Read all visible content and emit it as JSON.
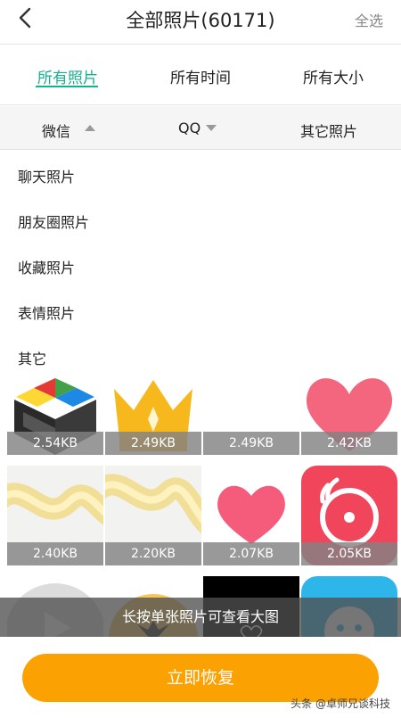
{
  "header": {
    "title": "全部照片(60171)",
    "select_all": "全选"
  },
  "filters": [
    {
      "label": "所有照片",
      "active": true
    },
    {
      "label": "所有时间",
      "active": false
    },
    {
      "label": "所有大小",
      "active": false
    }
  ],
  "sources": {
    "wechat": "微信",
    "qq": "QQ",
    "other": "其它照片"
  },
  "categories": [
    "聊天照片",
    "朋友圈照片",
    "收藏照片",
    "表情照片",
    "其它"
  ],
  "photos": [
    {
      "size": "2.54KB",
      "icon": "colorful-box-logo-icon"
    },
    {
      "size": "2.49KB",
      "icon": "crown-icon"
    },
    {
      "size": "2.49KB",
      "icon": "blank-image"
    },
    {
      "size": "2.42KB",
      "icon": "heart-icon"
    },
    {
      "size": "2.40KB",
      "icon": "golden-ribbon-image"
    },
    {
      "size": "2.20KB",
      "icon": "golden-ribbon-image"
    },
    {
      "size": "2.07KB",
      "icon": "heart-icon"
    },
    {
      "size": "2.05KB",
      "icon": "radio-app-icon"
    },
    {
      "icon": "play-button-icon"
    },
    {
      "icon": "crown-icon"
    },
    {
      "icon": "black-image"
    },
    {
      "icon": "smiley-app-icon"
    }
  ],
  "tooltip": "长按单张照片可查看大图",
  "restore_button": "立即恢复",
  "watermark": "头条 @卓师兄谈科技",
  "colors": {
    "accent": "#17b091",
    "button": "#fba102",
    "heart": "#f55b7a"
  }
}
